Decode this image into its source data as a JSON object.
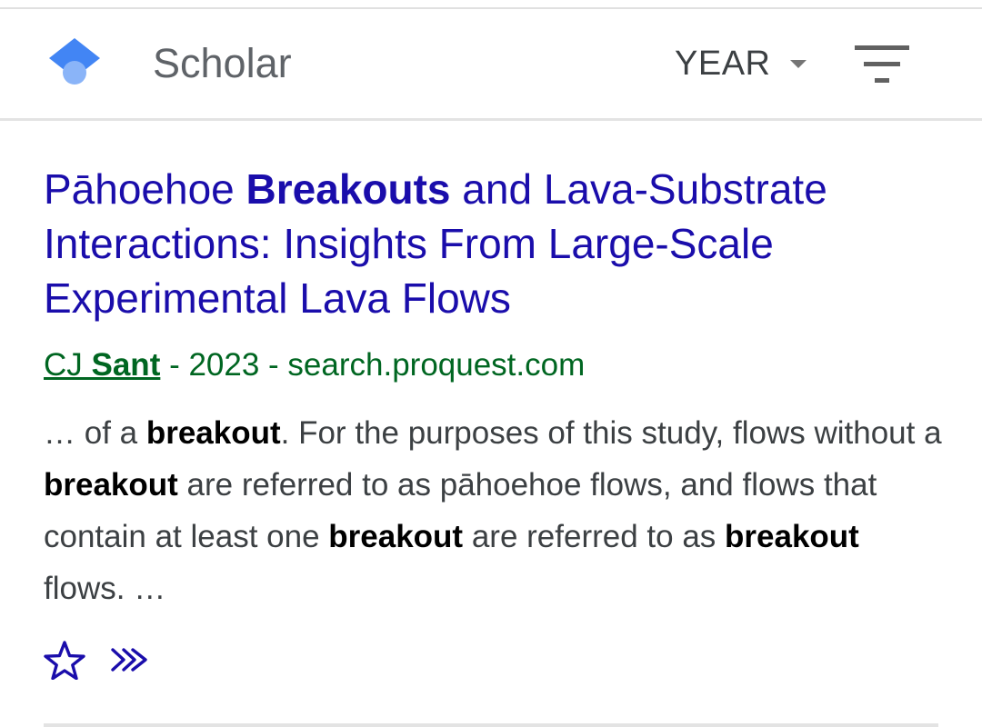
{
  "header": {
    "brand": "Scholar",
    "year_filter_label": "YEAR"
  },
  "result": {
    "title_parts": [
      "Pāhoehoe ",
      "Breakouts",
      " and Lava-Substrate Interactions: Insights From Large-Scale Experimental Lava Flows"
    ],
    "author_initials": "CJ ",
    "author_surname": "Sant",
    "meta_rest": " - 2023 - search.proquest.com",
    "snippet_parts": [
      "… of a ",
      "breakout",
      ". For the purposes of this study, flows without a ",
      "breakout",
      " are referred to as pāhoehoe flows, and flows that contain at least one ",
      "breakout",
      " are referred to as ",
      "breakout",
      " flows. …"
    ]
  },
  "icons": {
    "logo": "scholar-cap-icon",
    "year_caret": "caret-down-icon",
    "menu": "filter-lines-icon",
    "save": "star-outline-icon",
    "more": "double-chevron-right-icon"
  },
  "colors": {
    "link": "#1a0dab",
    "meta": "#006621",
    "snippet": "#3c4043",
    "brand": "#5f6368",
    "logo_blue_dark": "#4285f4",
    "logo_blue_light": "#8ab4f8",
    "icon_navy": "#1a0dab"
  }
}
